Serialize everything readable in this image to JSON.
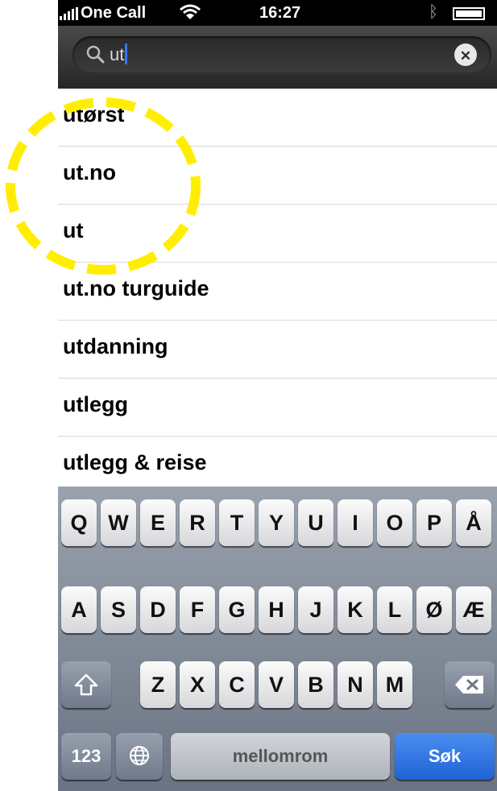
{
  "status_bar": {
    "carrier": "One Call",
    "time": "16:27"
  },
  "search": {
    "query": "ut",
    "icon": "search-icon",
    "clear_symbol": "✕"
  },
  "suggestions": [
    {
      "label": "utørst"
    },
    {
      "label": "ut.no"
    },
    {
      "label": "ut"
    },
    {
      "label": "ut.no turguide"
    },
    {
      "label": "utdanning"
    },
    {
      "label": "utlegg"
    },
    {
      "label": "utlegg & reise"
    }
  ],
  "annotation": {
    "color": "#ffee00"
  },
  "keyboard": {
    "row1": [
      "Q",
      "W",
      "E",
      "R",
      "T",
      "Y",
      "U",
      "I",
      "O",
      "P",
      "Å"
    ],
    "row2": [
      "A",
      "S",
      "D",
      "F",
      "G",
      "H",
      "J",
      "K",
      "L",
      "Ø",
      "Æ"
    ],
    "row3": [
      "Z",
      "X",
      "C",
      "V",
      "B",
      "N",
      "M"
    ],
    "numbers_label": "123",
    "space_label": "mellomrom",
    "return_label": "Søk",
    "accent_color": "#1f62d6"
  }
}
